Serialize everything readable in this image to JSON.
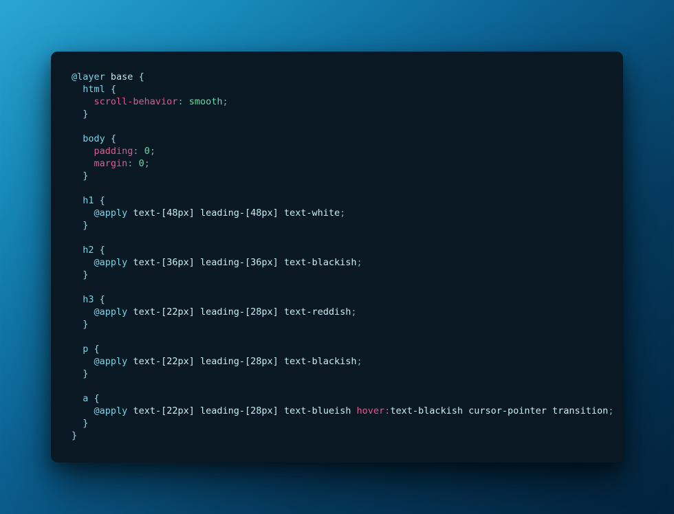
{
  "code": {
    "tokens": [
      {
        "cls": "tk-keyword",
        "t": "@layer"
      },
      {
        "cls": "plain",
        "t": " "
      },
      {
        "cls": "tk-base",
        "t": "base"
      },
      {
        "cls": "plain",
        "t": " "
      },
      {
        "cls": "tk-brace",
        "t": "{"
      },
      {
        "cls": "plain",
        "t": "\n  "
      },
      {
        "cls": "tk-tag",
        "t": "html"
      },
      {
        "cls": "plain",
        "t": " "
      },
      {
        "cls": "tk-brace",
        "t": "{"
      },
      {
        "cls": "plain",
        "t": "\n    "
      },
      {
        "cls": "tk-prop",
        "t": "scroll-behavior"
      },
      {
        "cls": "tk-punc",
        "t": ":"
      },
      {
        "cls": "plain",
        "t": " "
      },
      {
        "cls": "tk-val",
        "t": "smooth"
      },
      {
        "cls": "tk-punc",
        "t": ";"
      },
      {
        "cls": "plain",
        "t": "\n  "
      },
      {
        "cls": "tk-brace",
        "t": "}"
      },
      {
        "cls": "plain",
        "t": "\n\n  "
      },
      {
        "cls": "tk-tag",
        "t": "body"
      },
      {
        "cls": "plain",
        "t": " "
      },
      {
        "cls": "tk-brace",
        "t": "{"
      },
      {
        "cls": "plain",
        "t": "\n    "
      },
      {
        "cls": "tk-prop",
        "t": "padding"
      },
      {
        "cls": "tk-punc",
        "t": ":"
      },
      {
        "cls": "plain",
        "t": " "
      },
      {
        "cls": "tk-val",
        "t": "0"
      },
      {
        "cls": "tk-punc",
        "t": ";"
      },
      {
        "cls": "plain",
        "t": "\n    "
      },
      {
        "cls": "tk-prop",
        "t": "margin"
      },
      {
        "cls": "tk-punc",
        "t": ":"
      },
      {
        "cls": "plain",
        "t": " "
      },
      {
        "cls": "tk-val",
        "t": "0"
      },
      {
        "cls": "tk-punc",
        "t": ";"
      },
      {
        "cls": "plain",
        "t": "\n  "
      },
      {
        "cls": "tk-brace",
        "t": "}"
      },
      {
        "cls": "plain",
        "t": "\n\n  "
      },
      {
        "cls": "tk-tag",
        "t": "h1"
      },
      {
        "cls": "plain",
        "t": " "
      },
      {
        "cls": "tk-brace",
        "t": "{"
      },
      {
        "cls": "plain",
        "t": "\n    "
      },
      {
        "cls": "tk-keyword",
        "t": "@apply"
      },
      {
        "cls": "plain",
        "t": " "
      },
      {
        "cls": "tk-util",
        "t": "text-[48px] leading-[48px] text-white"
      },
      {
        "cls": "tk-punc",
        "t": ";"
      },
      {
        "cls": "plain",
        "t": "\n  "
      },
      {
        "cls": "tk-brace",
        "t": "}"
      },
      {
        "cls": "plain",
        "t": "\n\n  "
      },
      {
        "cls": "tk-tag",
        "t": "h2"
      },
      {
        "cls": "plain",
        "t": " "
      },
      {
        "cls": "tk-brace",
        "t": "{"
      },
      {
        "cls": "plain",
        "t": "\n    "
      },
      {
        "cls": "tk-keyword",
        "t": "@apply"
      },
      {
        "cls": "plain",
        "t": " "
      },
      {
        "cls": "tk-util",
        "t": "text-[36px] leading-[36px] text-blackish"
      },
      {
        "cls": "tk-punc",
        "t": ";"
      },
      {
        "cls": "plain",
        "t": "\n  "
      },
      {
        "cls": "tk-brace",
        "t": "}"
      },
      {
        "cls": "plain",
        "t": "\n\n  "
      },
      {
        "cls": "tk-tag",
        "t": "h3"
      },
      {
        "cls": "plain",
        "t": " "
      },
      {
        "cls": "tk-brace",
        "t": "{"
      },
      {
        "cls": "plain",
        "t": "\n    "
      },
      {
        "cls": "tk-keyword",
        "t": "@apply"
      },
      {
        "cls": "plain",
        "t": " "
      },
      {
        "cls": "tk-util",
        "t": "text-[22px] leading-[28px] text-reddish"
      },
      {
        "cls": "tk-punc",
        "t": ";"
      },
      {
        "cls": "plain",
        "t": "\n  "
      },
      {
        "cls": "tk-brace",
        "t": "}"
      },
      {
        "cls": "plain",
        "t": "\n\n  "
      },
      {
        "cls": "tk-tag",
        "t": "p"
      },
      {
        "cls": "plain",
        "t": " "
      },
      {
        "cls": "tk-brace",
        "t": "{"
      },
      {
        "cls": "plain",
        "t": "\n    "
      },
      {
        "cls": "tk-keyword",
        "t": "@apply"
      },
      {
        "cls": "plain",
        "t": " "
      },
      {
        "cls": "tk-util",
        "t": "text-[22px] leading-[28px] text-blackish"
      },
      {
        "cls": "tk-punc",
        "t": ";"
      },
      {
        "cls": "plain",
        "t": "\n  "
      },
      {
        "cls": "tk-brace",
        "t": "}"
      },
      {
        "cls": "plain",
        "t": "\n\n  "
      },
      {
        "cls": "tk-tag",
        "t": "a"
      },
      {
        "cls": "plain",
        "t": " "
      },
      {
        "cls": "tk-brace",
        "t": "{"
      },
      {
        "cls": "plain",
        "t": "\n    "
      },
      {
        "cls": "tk-keyword",
        "t": "@apply"
      },
      {
        "cls": "plain",
        "t": " "
      },
      {
        "cls": "tk-util",
        "t": "text-[22px] leading-[28px] text-blueish "
      },
      {
        "cls": "tk-prop",
        "t": "hover:"
      },
      {
        "cls": "tk-util",
        "t": "text-blackish cursor-pointer transition"
      },
      {
        "cls": "tk-punc",
        "t": ";"
      },
      {
        "cls": "plain",
        "t": "\n  "
      },
      {
        "cls": "tk-brace",
        "t": "}"
      },
      {
        "cls": "plain",
        "t": "\n"
      },
      {
        "cls": "tk-brace",
        "t": "}"
      }
    ],
    "render_id": "code-pre"
  }
}
